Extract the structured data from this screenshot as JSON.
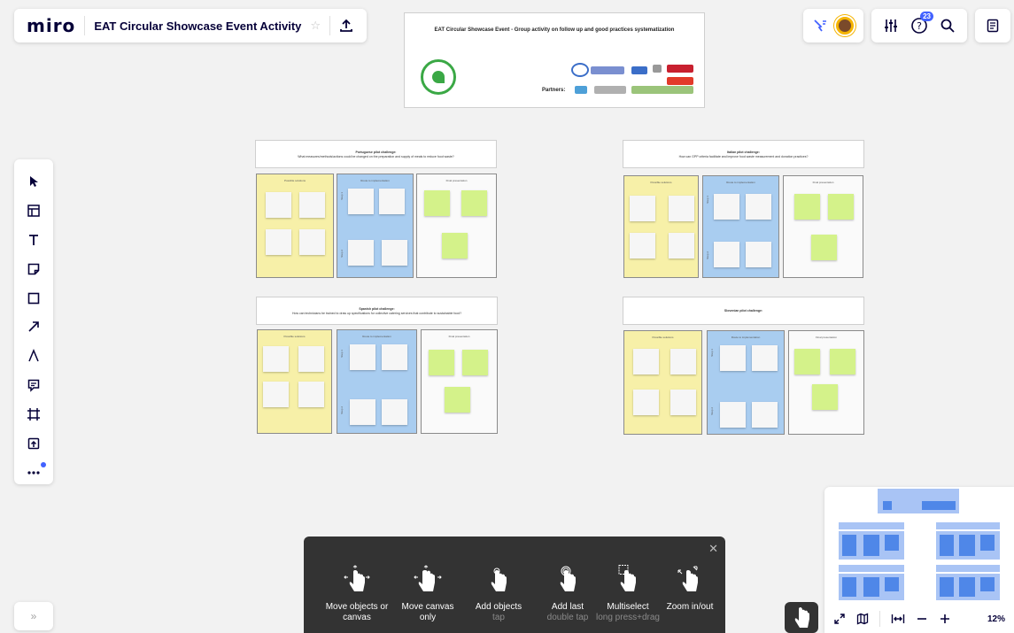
{
  "app": {
    "logo": "miro",
    "board_title": "EAT Circular Showcase Event Activity"
  },
  "topbar": {
    "notifications_count": "23"
  },
  "title_frame": {
    "title": "EAT Circular Showcase Event - Group activity on follow up and good practices systematization",
    "partners_label": "Partners:"
  },
  "challenges": [
    {
      "heading": "Portuguese pilot challenge:",
      "question": "What measures/methods/actions could be changed on the preparation and supply of meals to reduce food waste?",
      "col_labels": [
        "Possible solutions",
        "Route to implementation",
        "Final presentation"
      ]
    },
    {
      "heading": "Italian pilot challenge:",
      "question": "How can GPP criteria facilitate and improve food waste measurement and donation practices?",
      "col_labels": [
        "Possible solutions",
        "Route to implementation",
        "Final presentation"
      ]
    },
    {
      "heading": "Spanish pilot challenge:",
      "question": "How can technicians be trained to draw up specifications for collective catering services that contribute to sustainable food?",
      "col_labels": [
        "Possible solutions",
        "Route to implementation",
        "Final presentation"
      ]
    },
    {
      "heading": "Slovenian pilot challenge:",
      "question": "",
      "col_labels": [
        "Possible solutions",
        "Route to implementation",
        "Final presentation"
      ]
    }
  ],
  "side_labels": {
    "top": "Step 1",
    "bottom": "Step 2"
  },
  "minimap": {
    "zoom_level": "12%"
  },
  "gestures": {
    "items": [
      {
        "label": "Move objects or canvas",
        "sub": ""
      },
      {
        "label": "Move canvas only",
        "sub": ""
      },
      {
        "label": "Add objects",
        "sub": "tap"
      },
      {
        "label": "Add last",
        "sub": "double tap"
      },
      {
        "label": "Multiselect",
        "sub": "long press+drag"
      },
      {
        "label": "Zoom in/out",
        "sub": ""
      }
    ]
  },
  "colors": {
    "accent": "#4262ff",
    "sticky_yellow": "#f7f0a8",
    "sticky_blue": "#a9cdf0",
    "sticky_green": "#d4f28a"
  }
}
